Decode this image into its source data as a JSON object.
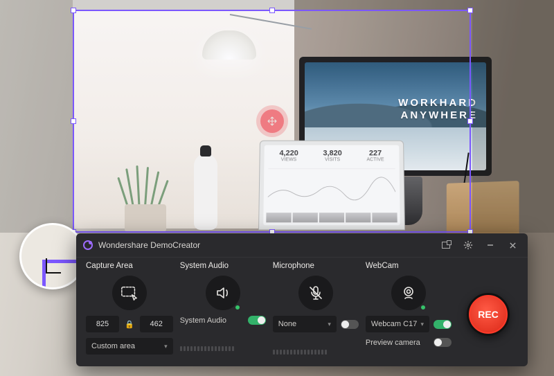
{
  "app": {
    "title": "Wondershare DemoCreator"
  },
  "desktop": {
    "monitor_text_line1": "WORKHARD",
    "monitor_text_line2": "ANYWHERE",
    "laptop_stats": [
      {
        "value": "4,220",
        "label": "VIEWS"
      },
      {
        "value": "3,820",
        "label": "VISITS"
      },
      {
        "value": "227",
        "label": "ACTIVE"
      }
    ]
  },
  "selection": {
    "width": "825",
    "height": "462"
  },
  "capture": {
    "title": "Capture Area",
    "mode_label": "Custom area"
  },
  "system_audio": {
    "title": "System Audio",
    "label": "System Audio",
    "enabled": true
  },
  "microphone": {
    "title": "Microphone",
    "selected": "None",
    "enabled": false
  },
  "webcam": {
    "title": "WebCam",
    "selected": "Webcam C17",
    "enabled": true,
    "preview_label": "Preview camera",
    "preview_enabled": false
  },
  "record": {
    "label": "REC"
  }
}
